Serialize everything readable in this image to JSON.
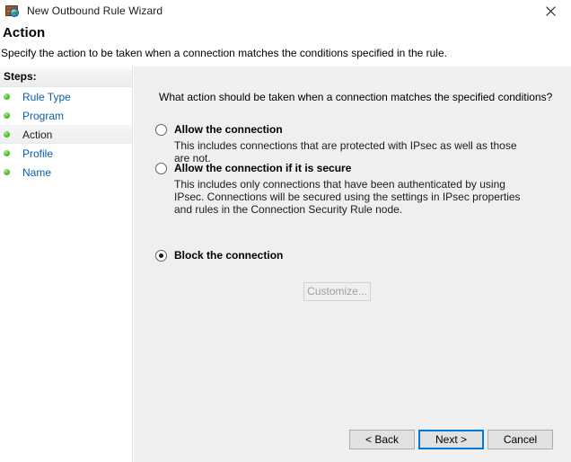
{
  "window": {
    "title": "New Outbound Rule Wizard",
    "icon": "firewall-brick-globe-icon",
    "close_label": "✕"
  },
  "header": {
    "title": "Action",
    "subtitle": "Specify the action to be taken when a connection matches the conditions specified in the rule."
  },
  "sidebar": {
    "header_label": "Steps:",
    "items": [
      {
        "label": "Rule Type",
        "current": false
      },
      {
        "label": "Program",
        "current": false
      },
      {
        "label": "Action",
        "current": true
      },
      {
        "label": "Profile",
        "current": false
      },
      {
        "label": "Name",
        "current": false
      }
    ]
  },
  "main": {
    "question": "What action should be taken when a connection matches the specified conditions?",
    "options": [
      {
        "label": "Allow the connection",
        "description": "This includes connections that are protected with IPsec as well as those are not.",
        "selected": false
      },
      {
        "label": "Allow the connection if it is secure",
        "description": "This includes only connections that have been authenticated by using IPsec.  Connections will be secured using the settings in IPsec properties and rules in the Connection Security Rule node.",
        "selected": false
      },
      {
        "label": "Block the connection",
        "description": "",
        "selected": true
      }
    ],
    "customize_button": {
      "label": "Customize...",
      "enabled": false
    }
  },
  "footer": {
    "back_label": "< Back",
    "next_label": "Next >",
    "cancel_label": "Cancel"
  },
  "colors": {
    "accent": "#0078d7",
    "link": "#0b5ea8",
    "panel": "#efefef",
    "bullet": "#5fc93a"
  }
}
